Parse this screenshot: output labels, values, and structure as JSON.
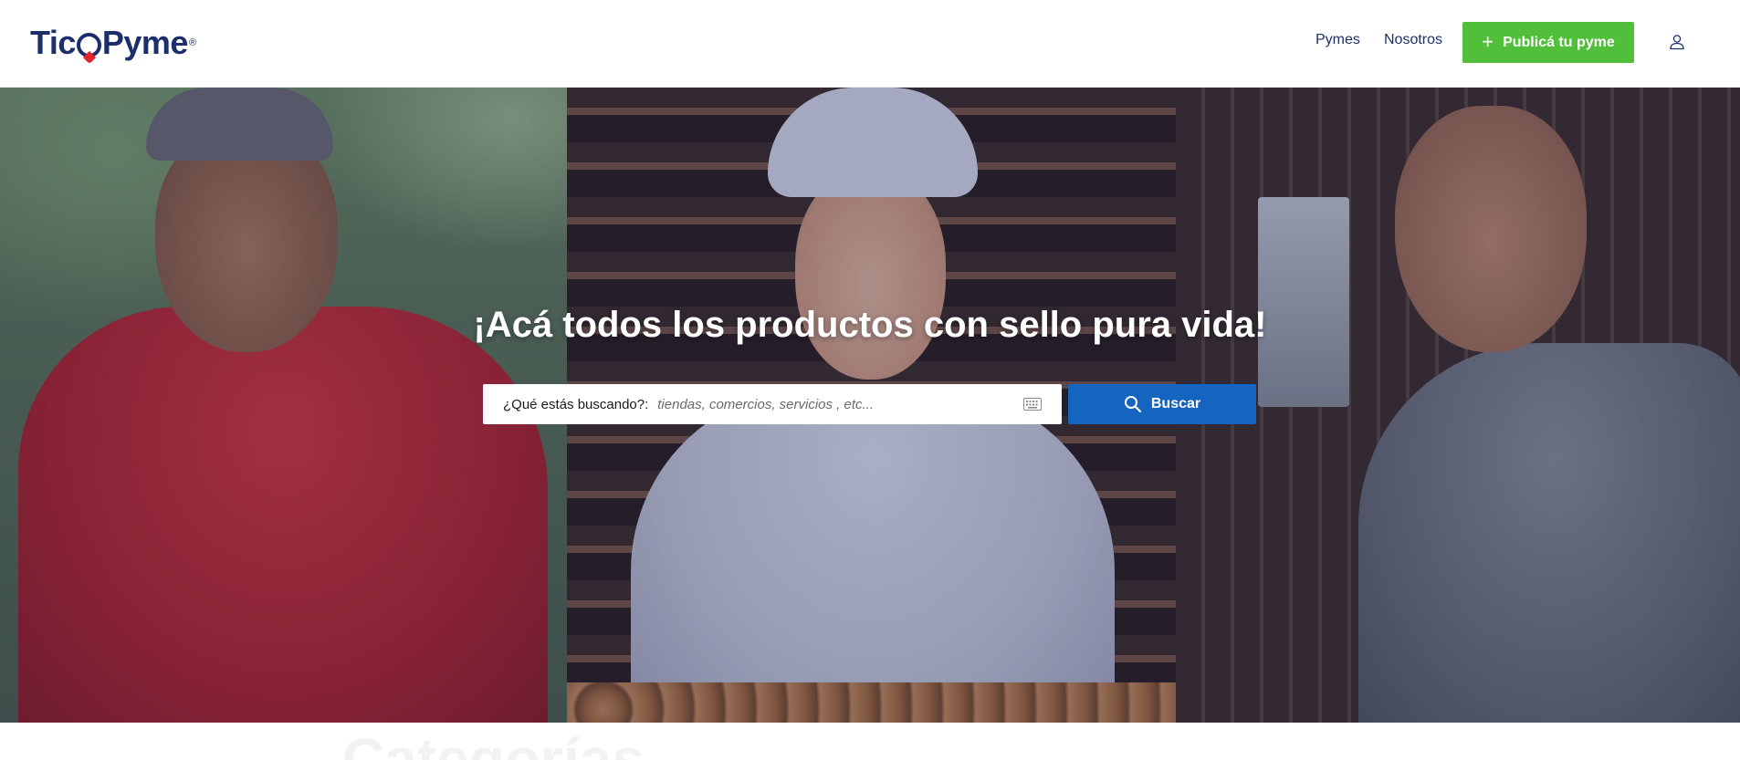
{
  "header": {
    "logo_left": "Tic",
    "logo_right": "Pyme",
    "logo_mark": "®",
    "nav": [
      {
        "label": "Pymes"
      },
      {
        "label": "Nosotros"
      }
    ],
    "publish_button": {
      "icon": "plus-icon",
      "label": "Publicá tu pyme"
    },
    "user_icon": "user-icon"
  },
  "colors": {
    "brand_blue": "#1c2f6b",
    "accent_green": "#52bf3a",
    "search_button_blue": "#1565c0",
    "logo_red": "#e2232a"
  },
  "hero": {
    "title": "¡Acá todos los productos con sello pura vida!",
    "search": {
      "label": "¿Qué estás buscando?:",
      "placeholder": "tiendas, comercios, servicios , etc...",
      "value": "",
      "keyboard_icon": "keyboard-icon"
    },
    "search_button": {
      "icon": "search-icon",
      "label": "Buscar"
    }
  },
  "section": {
    "partial_heading": "Categorías"
  }
}
